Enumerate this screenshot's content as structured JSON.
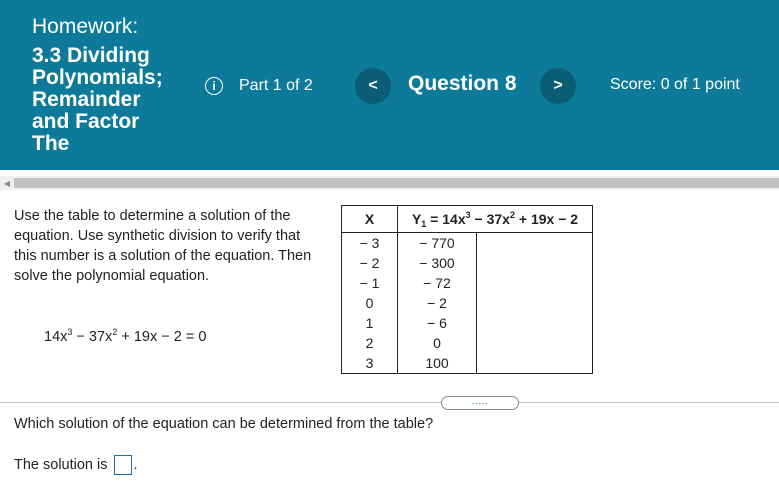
{
  "header": {
    "homework_label": "Homework:",
    "homework_title_lines": [
      "3.3 Dividing",
      "Polynomials;",
      "Remainder",
      "and Factor",
      "The"
    ],
    "info_icon": "info-icon",
    "part_label": "Part 1 of 2",
    "prev_icon": "chevron-left-icon",
    "prev_glyph": "<",
    "question_label": "Question 8",
    "next_icon": "chevron-right-icon",
    "next_glyph": ">",
    "score_label": "Score: 0 of 1 point",
    "colors": {
      "header_bg": "#0e7a99",
      "nav_button": "#0a5d75"
    }
  },
  "problem": {
    "instructions": "Use the table to determine a solution of the equation.  Use synthetic division to verify that this number is a solution of the equation.  Then solve the polynomial equation.",
    "equation": {
      "part1": "14x",
      "exp1": "3",
      "part2": " − 37x",
      "exp2": "2",
      "part3": " + 19x − 2 = 0"
    }
  },
  "table": {
    "x_header": "X",
    "y_header": {
      "y": "Y",
      "sub": "1",
      "part1": " = 14x",
      "exp1": "3",
      "part2": " − 37x",
      "exp2": "2",
      "part3": " + 19x − 2"
    },
    "rows": [
      {
        "x": "− 3",
        "y": "− 770"
      },
      {
        "x": "− 2",
        "y": "− 300"
      },
      {
        "x": "− 1",
        "y": "− 72"
      },
      {
        "x": "0",
        "y": "− 2"
      },
      {
        "x": "1",
        "y": "− 6"
      },
      {
        "x": "2",
        "y": "0"
      },
      {
        "x": "3",
        "y": "100"
      }
    ]
  },
  "more_button": ".....",
  "question_text": "Which solution of the equation can be determined from the table?",
  "answer": {
    "label": "The solution is",
    "value": "",
    "suffix": "."
  }
}
